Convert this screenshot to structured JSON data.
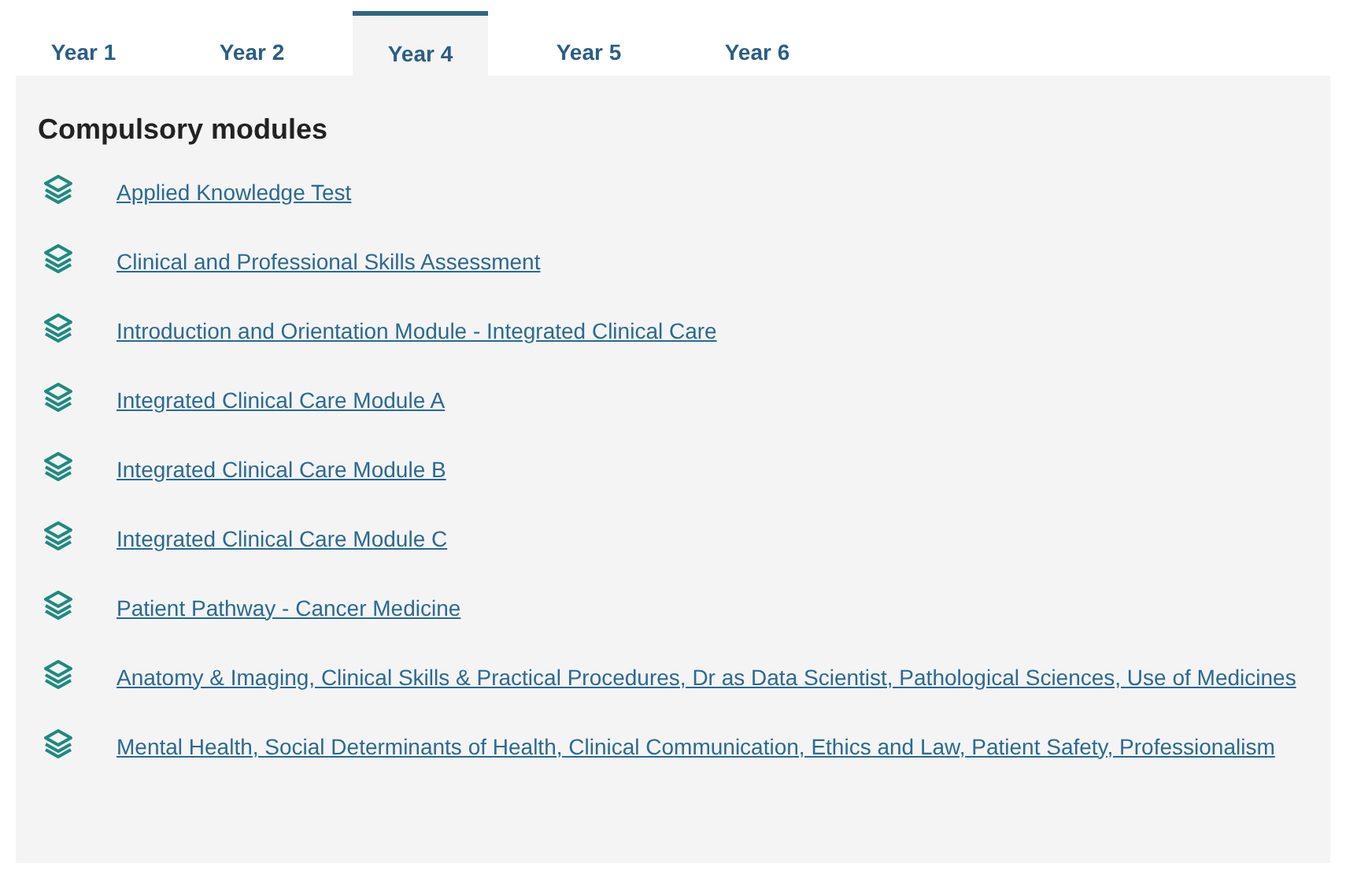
{
  "tabs": [
    {
      "label": "Year 1",
      "selected": false
    },
    {
      "label": "Year 2",
      "selected": false
    },
    {
      "label": "Year 4",
      "selected": true
    },
    {
      "label": "Year 5",
      "selected": false
    },
    {
      "label": "Year 6",
      "selected": false
    }
  ],
  "panel": {
    "heading": "Compulsory modules",
    "modules": [
      {
        "label": "Applied Knowledge Test"
      },
      {
        "label": "Clinical and Professional Skills Assessment"
      },
      {
        "label": "Introduction and Orientation Module - Integrated Clinical Care"
      },
      {
        "label": "Integrated Clinical Care Module A"
      },
      {
        "label": "Integrated Clinical Care Module B"
      },
      {
        "label": "Integrated Clinical Care Module C"
      },
      {
        "label": "Patient Pathway - Cancer Medicine"
      },
      {
        "label": "Anatomy & Imaging, Clinical Skills & Practical Procedures, Dr as Data Scientist, Pathological Sciences, Use of Medicines"
      },
      {
        "label": "Mental Health, Social Determinants of Health, Clinical Communication, Ethics and Law, Patient Safety, Professionalism"
      }
    ]
  }
}
